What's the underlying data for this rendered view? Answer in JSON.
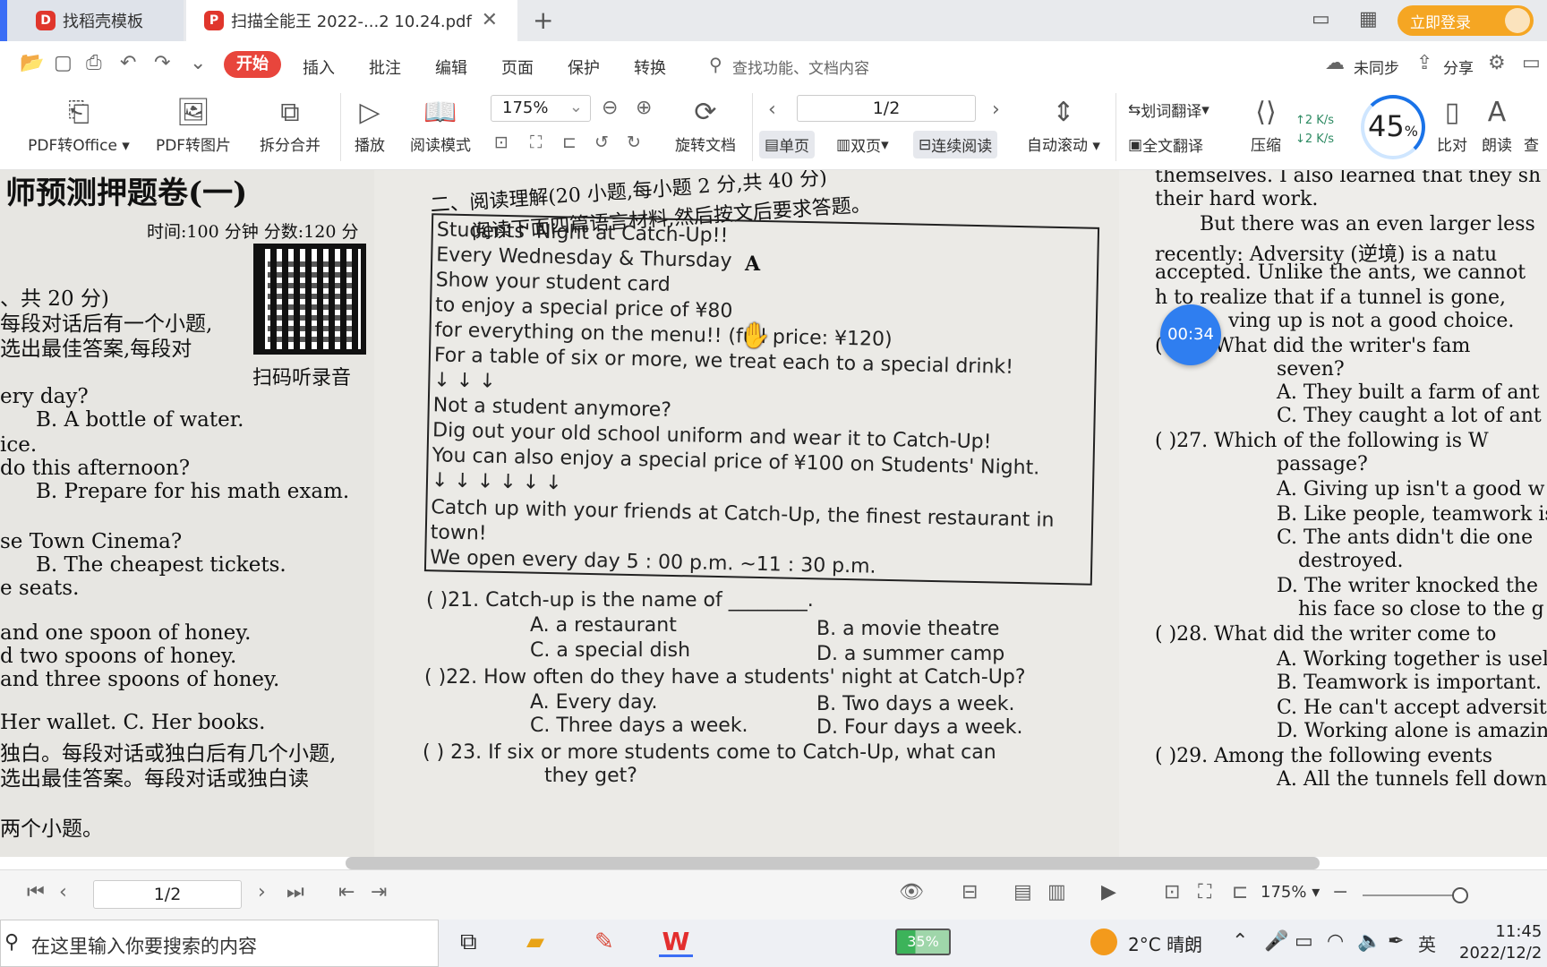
{
  "tabs": {
    "home": "找稻壳模板",
    "doc": "扫描全能王 2022-...2 10.24.pdf",
    "new": "+",
    "login": "立即登录"
  },
  "menu": {
    "start": "开始",
    "items": [
      "插入",
      "批注",
      "编辑",
      "页面",
      "保护",
      "转换"
    ],
    "search": "查找功能、文档内容",
    "sync": "未同步",
    "share": "分享"
  },
  "ribbon": {
    "pdf_office": "PDF转Office",
    "pdf_image": "PDF转图片",
    "split_merge": "拆分合并",
    "play": "播放",
    "read_mode": "阅读模式",
    "zoom": "175%",
    "rotate": "旋转文档",
    "page": "1/2",
    "single": "单页",
    "double": "双页",
    "continuous": "连续阅读",
    "autoscroll": "自动滚动",
    "word_translate": "划词翻译",
    "full_translate": "全文翻译",
    "compress": "压缩",
    "compare": "比对",
    "read_aloud": "朗读",
    "find": "查",
    "net_up": "↑2  K/s",
    "net_down": "↓2  K/s",
    "progress": "45",
    "progress_unit": "%"
  },
  "left_page": {
    "lines": [
      "师预测押题卷(一)",
      "时间:100 分钟   分数:120 分",
      "、共 20 分)",
      "每段对话后有一个小题,",
      "选出最佳答案,每段对",
      "扫码听录音",
      "ery day?",
      "B. A bottle of water.",
      "ice.",
      "do this afternoon?",
      "B. Prepare for his math exam.",
      "se Town Cinema?",
      "B. The cheapest tickets.",
      "e seats.",
      "and one spoon of honey.",
      "d two spoons of honey.",
      "and three spoons of honey.",
      "Her wallet.              C. Her books.",
      "独白。每段对话或独白后有几个小题,",
      "选出最佳答案。每段对话或独白读",
      "两个小题。"
    ]
  },
  "mid_page": {
    "section": "二、阅读理解(20 小题,每小题 2 分,共 40 分)",
    "instruction": "阅读下面四篇语言材料,然后按文后要求答题。",
    "passage_letter": "A",
    "ad_lines": [
      "Students' Night at Catch-Up!!",
      "Every Wednesday & Thursday",
      "Show your student card",
      "to enjoy a special price of ¥80",
      "for everything on the menu!! (full price: ¥120)",
      "For a table of six or more, we treat each to a special drink!",
      "↓ ↓ ↓",
      "Not a student anymore?",
      "Dig out your old school uniform and wear it to Catch-Up!",
      "You can also enjoy a special price of ¥100 on Students' Night.",
      "↓ ↓ ↓ ↓ ↓ ↓",
      "Catch up with your friends at Catch-Up, the finest restaurant in",
      "town!",
      "We open every day 5 : 00 p.m. ~11 : 30 p.m."
    ],
    "q21": "(      )21. Catch-up is the name of ________.",
    "q21_opts": [
      "A. a restaurant",
      "B. a movie theatre",
      "C. a special dish",
      "D. a summer camp"
    ],
    "q22": "(      )22. How often do they have a students' night at Catch-Up?",
    "q22_opts": [
      "A. Every day.",
      "B. Two days a week.",
      "C. Three days a week.",
      "D. Four days a week."
    ],
    "q23": "(      ) 23. If six or more students come to Catch-Up, what can",
    "q23_b": "they get?"
  },
  "right_page": {
    "lines": [
      "themselves. I also learned that they sh",
      "their hard work.",
      "But there was an even larger less",
      "recently: Adversity (逆境) is a natu",
      "accepted. Unlike the ants, we cannot",
      "h    to realize that if a tunnel is gone,",
      "ving up is not a good choice.",
      "(       )26. What did the writer's fam",
      "seven?",
      "A. They built a farm of ant",
      "C. They caught a lot of ant",
      "(       )27. Which of the following is W",
      "passage?",
      "A. Giving up isn't a good w",
      "B. Like people, teamwork is",
      "C. The ants didn't die one",
      "destroyed.",
      "D. The writer knocked the",
      "his face so close to the g",
      "(       )28. What did the writer come to",
      "A. Working together is usele",
      "B. Teamwork is important.",
      "C. He can't accept adversit",
      "D. Working alone is amazing",
      "(       )29. Among the following events",
      "A. All the tunnels fell down."
    ]
  },
  "timer": "00:34",
  "bottom": {
    "page": "1/2",
    "zoom": "175%"
  },
  "taskbar": {
    "search": "在这里输入你要搜索的内容",
    "battery": "35%",
    "temp": "2°C",
    "weather": "晴朗",
    "ime": "英",
    "time": "11:45",
    "date": "2022/12/2"
  }
}
